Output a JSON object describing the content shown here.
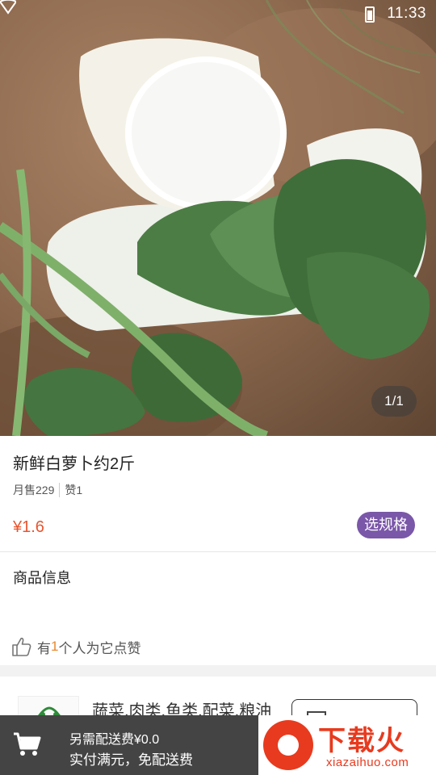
{
  "status": {
    "time": "11:33"
  },
  "hero": {
    "pager": "1/1"
  },
  "product": {
    "title": "新鲜白萝卜约2斤",
    "monthly_sales": "月售229",
    "likes_short": "赞1",
    "price": "¥1.6",
    "spec_button": "选规格"
  },
  "detail": {
    "title": "商品信息",
    "likes_prefix": "有",
    "likes_count": "1",
    "likes_suffix": "个人为它点赞"
  },
  "store": {
    "description": "蔬菜.肉类.鱼类.配菜.粮油"
  },
  "cart": {
    "delivery_fee": "另需配送费¥0.0",
    "free_delivery": "实付满元，免配送费"
  },
  "watermark": {
    "brand": "下载火",
    "site": "xiazaihuo.com"
  },
  "colors": {
    "price": "#e8552f",
    "accent": "#7a57a8",
    "like_count": "#e8892f"
  }
}
